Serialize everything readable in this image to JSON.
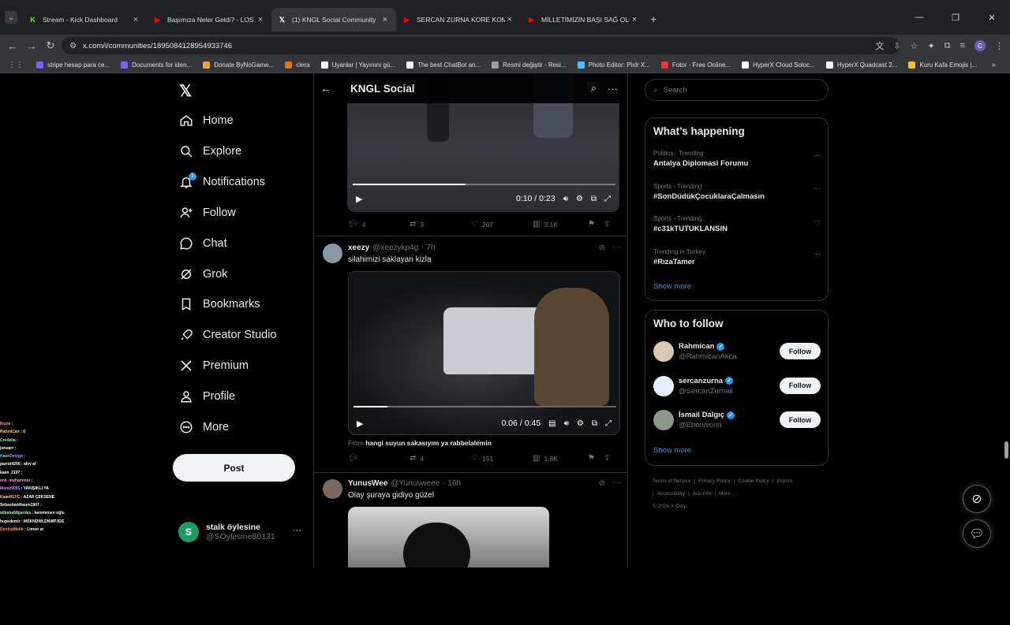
{
  "browser": {
    "tabs": [
      {
        "title": "Stream - Kick Dashboard",
        "icon": "kick-icon",
        "active": false
      },
      {
        "title": "Başımıza Neler Geldi? - LOS ANGE",
        "icon": "youtube-icon",
        "active": false
      },
      {
        "title": "(1) KNGL Social Community",
        "icon": "x-icon",
        "active": true
      },
      {
        "title": "SERCAN ZURNA KORE KOMİK ANLAR",
        "icon": "youtube-icon",
        "active": false
      },
      {
        "title": "MİLLETİMİZİN BAŞI SAĞ OLSUN",
        "icon": "youtube-icon",
        "active": false
      }
    ],
    "url": "x.com/i/communities/1895084128954933746",
    "profile_letter": "C",
    "bookmarks": [
      {
        "label": "stripe hesap para ce...",
        "color": "#7b61ff"
      },
      {
        "label": "Documents for iden...",
        "color": "#7b61ff"
      },
      {
        "label": "Donate ByNoGame...",
        "color": "#f5a623"
      },
      {
        "label": "clera",
        "color": "#e8710a"
      },
      {
        "label": "Uyanlar | Yayınını gü...",
        "color": "#ffffff"
      },
      {
        "label": "The best ChatBot an...",
        "color": "#ffffff"
      },
      {
        "label": "Resmi değiştir - Resi...",
        "color": "#9aa0a6"
      },
      {
        "label": "Photo Editor: Pixlr X...",
        "color": "#4fc3f7"
      },
      {
        "label": "Fotor - Free Online...",
        "color": "#e53935"
      },
      {
        "label": "HyperX Cloud Soloc...",
        "color": "#ffffff"
      },
      {
        "label": "HyperX Quadcast 2...",
        "color": "#ffffff"
      },
      {
        "label": "Kuru Kafa Emojis |...",
        "color": "#fbc02d"
      }
    ]
  },
  "chat_overlay": [
    {
      "user": "Rozia",
      "color": "#ff9b9b",
      "msg": ""
    },
    {
      "user": "RahmiCan",
      "color": "#ffd36b",
      "msg": "0"
    },
    {
      "user": "Credella",
      "color": "#9bff9b",
      "msg": ""
    },
    {
      "user": "jonuarr",
      "color": "#ffffff",
      "msg": ""
    },
    {
      "user": "KaanDesign",
      "color": "#6bc3ff",
      "msg": ""
    },
    {
      "user": "parrot4206",
      "color": "#ffffff",
      "msg": "alev al"
    },
    {
      "user": "kaan_2107",
      "color": "#ffffff",
      "msg": ""
    },
    {
      "user": "enk_muhammet",
      "color": "#ff9bd6",
      "msg": ""
    },
    {
      "user": "Maraz9095",
      "color": "#c38bff",
      "msg": "YAKIŞIKLI YA"
    },
    {
      "user": "KaanKLYC",
      "color": "#ffd36b",
      "msg": "AZAR ÇEKSENE"
    },
    {
      "user": "SebastianHasen1907",
      "color": "#ffffff",
      "msg": ""
    },
    {
      "user": "alibaba68gardas",
      "color": "#9bff9b",
      "msg": "kanımenen oğlu"
    },
    {
      "user": "hupedemir",
      "color": "#ffffff",
      "msg": "MSKNDWLDNWPJDS"
    },
    {
      "user": "DentistMelih",
      "color": "#ff9b6b",
      "msg": "Limon at"
    }
  ],
  "nav": {
    "items": [
      {
        "label": "Home",
        "icon": "home-icon"
      },
      {
        "label": "Explore",
        "icon": "search-icon"
      },
      {
        "label": "Notifications",
        "icon": "bell-icon",
        "badge": "1"
      },
      {
        "label": "Follow",
        "icon": "person-add-icon"
      },
      {
        "label": "Chat",
        "icon": "chat-icon"
      },
      {
        "label": "Grok",
        "icon": "grok-icon"
      },
      {
        "label": "Bookmarks",
        "icon": "bookmark-icon"
      },
      {
        "label": "Creator Studio",
        "icon": "rocket-icon"
      },
      {
        "label": "Premium",
        "icon": "x-icon"
      },
      {
        "label": "Profile",
        "icon": "person-icon"
      },
      {
        "label": "More",
        "icon": "more-circle-icon"
      }
    ],
    "post_label": "Post",
    "account": {
      "name": "stalk öylesine",
      "handle": "@SOylesine80131",
      "avatar_letter": "S"
    }
  },
  "feed": {
    "title": "KNGL Social",
    "video1": {
      "time": "0:10 / 0:23",
      "progress": 0.43
    },
    "stats1": {
      "replies": "4",
      "reposts": "3",
      "likes": "207",
      "views": "3.1K"
    },
    "tweet2": {
      "name": "xeezy",
      "handle": "@xeezykp4g",
      "age": "· 7h",
      "text": "silahimizi saklayan kizla",
      "video_time": "0:06 / 0:45",
      "progress": 0.13,
      "from_prefix": "From",
      "from_source": "hangi suyun sakasıyım ya rabbelalemin",
      "stats": {
        "replies": "",
        "reposts": "4",
        "likes": "151",
        "views": "1.8K"
      }
    },
    "tweet3": {
      "name": "YunusWee",
      "handle": "@Yunusweee",
      "age": "· 16h",
      "text": "Olay şuraya gidiyo güzel"
    }
  },
  "sidebar": {
    "search_placeholder": "Search",
    "trends_title": "What’s happening",
    "trends": [
      {
        "category": "Politics · Trending",
        "name": "Antalya Diplomasi Forumu"
      },
      {
        "category": "Sports · Trending",
        "name": "#SonDüdükÇocuklaraÇalmasın"
      },
      {
        "category": "Sports · Trending",
        "name": "#c31kTUTUKLANSIN"
      },
      {
        "category": "Trending in Turkey",
        "name": "#RızaTamer"
      }
    ],
    "show_more": "Show more",
    "wtf_title": "Who to follow",
    "wtf": [
      {
        "name": "Rahmican",
        "handle": "@RahmicanAkca",
        "follow": "Follow"
      },
      {
        "name": "sercanzurna",
        "handle": "@SercanZurnall",
        "follow": "Follow"
      },
      {
        "name": "İsmail Dalgıç",
        "handle": "@Ebonivonn",
        "follow": "Follow"
      }
    ],
    "footer": [
      "Terms of Service",
      "|",
      "Privacy Policy",
      "|",
      "Cookie Policy",
      "|",
      "Imprint",
      "|",
      "Accessibility",
      "|",
      "Ads info",
      "|",
      "More ···",
      "© 2026 X Corp."
    ]
  }
}
